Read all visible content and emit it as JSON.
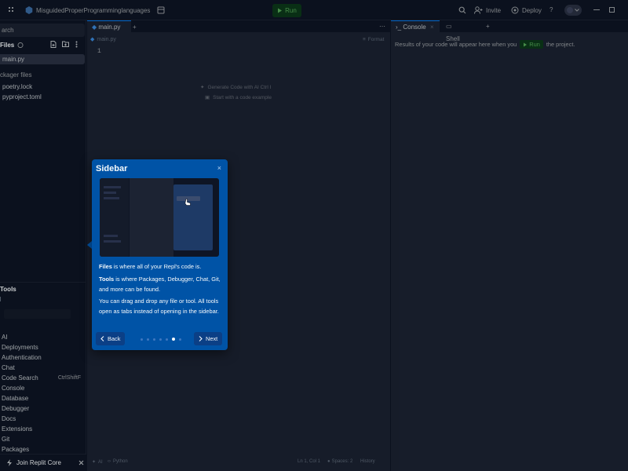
{
  "topbar": {
    "repl_name": "MisguidedProperProgramminglanguages",
    "run_label": "Run",
    "invite_label": "Invite",
    "deploy_label": "Deploy",
    "help_label": "?"
  },
  "sidebar": {
    "search_placeholder": "arch",
    "files_label": "Files",
    "files": [
      {
        "name": "main.py",
        "active": true
      }
    ],
    "packager_label": "ckager files",
    "packager_files": [
      "poetry.lock",
      "pyproject.toml"
    ],
    "tools_label": "Tools",
    "tools": [
      {
        "name": "AI",
        "shortcut": ""
      },
      {
        "name": "Deployments",
        "shortcut": ""
      },
      {
        "name": "Authentication",
        "shortcut": ""
      },
      {
        "name": "Chat",
        "shortcut": ""
      },
      {
        "name": "Code Search",
        "shortcut": "CtrlShiftF"
      },
      {
        "name": "Console",
        "shortcut": ""
      },
      {
        "name": "Database",
        "shortcut": ""
      },
      {
        "name": "Debugger",
        "shortcut": ""
      },
      {
        "name": "Docs",
        "shortcut": ""
      },
      {
        "name": "Extensions",
        "shortcut": ""
      },
      {
        "name": "Git",
        "shortcut": ""
      },
      {
        "name": "Packages",
        "shortcut": ""
      }
    ],
    "join_label": "Join Replit Core"
  },
  "editor": {
    "tab_label": "main.py",
    "breadcrumb": "main.py",
    "format_label": "Format",
    "line_number": "1",
    "hint_ai": "Generate Code with AI  Ctrl  I",
    "hint_example": "Start with a code example"
  },
  "console": {
    "tab_console": "Console",
    "tab_shell": "Shell",
    "message_before": "Results of your code will appear here when you",
    "run_label": "Run",
    "message_after": "the project."
  },
  "statusbar": {
    "ai_label": "AI",
    "language": "Python",
    "position": "Ln 1, Col 1",
    "spaces": "Spaces: 2",
    "history": "History"
  },
  "popup": {
    "title": "Sidebar",
    "files_bold": "Files",
    "files_text": " is where all of your Repl's code is.",
    "tools_bold": "Tools",
    "tools_text": " is where Packages, Debugger, Chat, Git, and more can be found.",
    "drag_text": "You can drag and drop any file or tool. All tools open as tabs instead of opening in the sidebar.",
    "back_label": "Back",
    "next_label": "Next",
    "steps_total": 7,
    "step_current": 6
  },
  "colors": {
    "background": "#0e1525",
    "panel": "#1c2333",
    "accent": "#0079f2",
    "popup": "#0053a6",
    "run_green": "#57ab5a"
  }
}
